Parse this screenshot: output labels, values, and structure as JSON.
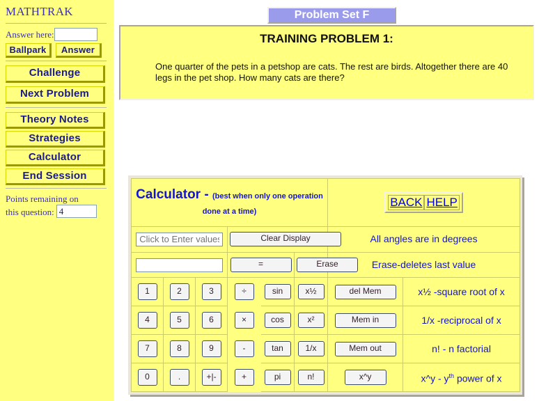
{
  "sidebar": {
    "brand": "MATHTRAK",
    "answer_label": "Answer here:",
    "answer_value": "",
    "ballpark_label": "Ballpark",
    "answer_button_label": "Answer",
    "challenge_label": "Challenge",
    "next_problem_label": "Next Problem",
    "theory_notes_label": "Theory Notes",
    "strategies_label": "Strategies",
    "calculator_label": "Calculator",
    "end_session_label": "End Session",
    "points_text_line1": "Points remaining on",
    "points_text_line2": "this question:",
    "points_value": "4"
  },
  "header": {
    "problem_set_tab": "Problem Set F",
    "problem_title": "TRAINING PROBLEM 1:",
    "problem_text": "One quarter of the pets in a petshop are cats. The rest are birds. Altogether there are 40 legs in the pet shop. How many cats are there?"
  },
  "calculator": {
    "title": "Calculator -",
    "subtitle": "(best when only one operation done at a time)",
    "back_label": "BACK",
    "help_label": "HELP",
    "entry_placeholder": "Click to Enter values",
    "entry_value": "",
    "clear_display_label": "Clear Display",
    "display_value": "",
    "equals_label": "=",
    "erase_label": "Erase",
    "del_mem_label": "del Mem",
    "mem_in_label": "Mem in",
    "mem_out_label": "Mem out",
    "power_label": "x^y",
    "keys": {
      "k1": "1",
      "k2": "2",
      "k3": "3",
      "k4": "4",
      "k5": "5",
      "k6": "6",
      "k7": "7",
      "k8": "8",
      "k9": "9",
      "k0": "0",
      "kdot": ".",
      "ksign": "+|-"
    },
    "ops": {
      "divide": "÷",
      "multiply": "×",
      "minus": "-",
      "plus": "+"
    },
    "funcs": {
      "sin": "sin",
      "sqrt": "x½",
      "cos": "cos",
      "sq": "x²",
      "tan": "tan",
      "recip": "1/x",
      "pi": "pi",
      "fact": "n!"
    },
    "hints": {
      "angles": "All angles are in degrees",
      "erase": "Erase-deletes last value",
      "sqrt": "x½ -square root of x",
      "recip": "1/x -reciprocal of x",
      "fact": "n! - n factorial",
      "power_prefix": "x^y - y",
      "power_sup": "th",
      "power_suffix": " power of x"
    }
  }
}
